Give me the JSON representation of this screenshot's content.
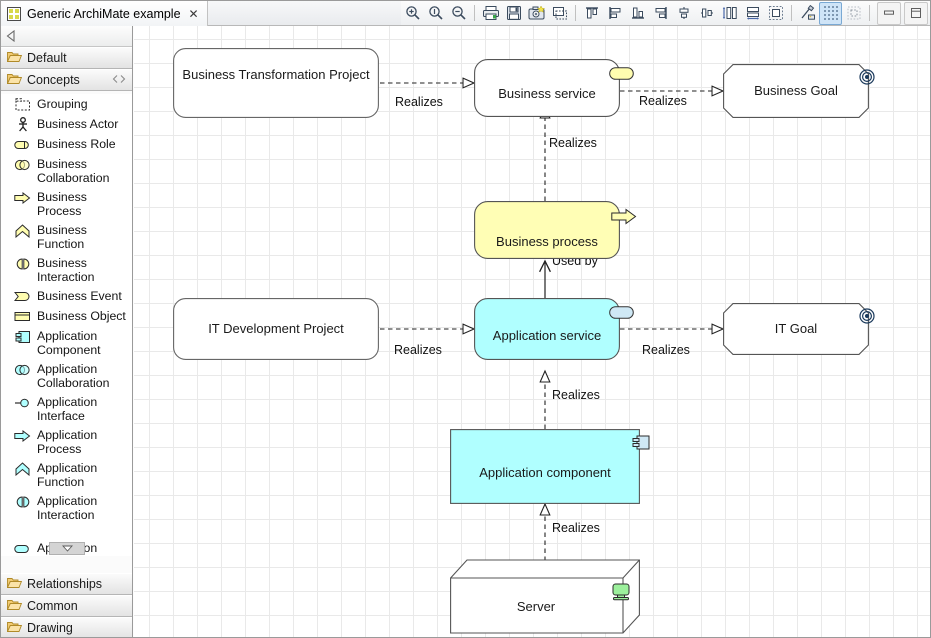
{
  "window": {
    "tab": {
      "title": "Generic ArchiMate example",
      "icon": "archimate-model-icon",
      "close": "✕"
    },
    "buttons": {
      "minimize": "minimize",
      "maximize": "maximize"
    }
  },
  "toolbar": {
    "items": [
      {
        "name": "zoom-in-icon",
        "label": "Zoom In"
      },
      {
        "name": "zoom-normal-icon",
        "label": "Zoom Normal"
      },
      {
        "name": "zoom-out-icon",
        "label": "Zoom Out"
      },
      {
        "name": "print-icon",
        "label": "Print"
      },
      {
        "name": "save-icon",
        "label": "Save"
      },
      {
        "name": "export-image-icon",
        "label": "Export as Image"
      },
      {
        "name": "fill-color-icon",
        "label": "Fill Color"
      },
      {
        "name": "align-top-icon",
        "label": "Align Top"
      },
      {
        "name": "align-left-icon",
        "label": "Align Left"
      },
      {
        "name": "align-bottom-icon",
        "label": "Align Bottom"
      },
      {
        "name": "align-right-icon",
        "label": "Align Right"
      },
      {
        "name": "align-center-icon",
        "label": "Align Center"
      },
      {
        "name": "align-middle-icon",
        "label": "Align Middle"
      },
      {
        "name": "match-height-icon",
        "label": "Match Height"
      },
      {
        "name": "match-width-icon",
        "label": "Match Width"
      },
      {
        "name": "default-size-icon",
        "label": "Default Size"
      },
      {
        "name": "format-painter-icon",
        "label": "Format Painter"
      },
      {
        "name": "toggle-grid-icon",
        "label": "Toggle Grid"
      },
      {
        "name": "snap-to-grid-icon",
        "label": "Snap to Grid"
      }
    ]
  },
  "sidebar": {
    "nav_back": "back-arrow",
    "sections": {
      "default": {
        "label": "Default",
        "icon": "folder-icon"
      },
      "concepts": {
        "label": "Concepts",
        "icon": "folder-icon",
        "collapse": "collapse-icon"
      }
    },
    "items": [
      {
        "label": "Grouping",
        "icon": "grouping-icon",
        "layer": "other"
      },
      {
        "label": "Business Actor",
        "icon": "business-actor-icon",
        "layer": "business"
      },
      {
        "label": "Business Role",
        "icon": "business-role-icon",
        "layer": "business"
      },
      {
        "label": "Business Collaboration",
        "icon": "business-collaboration-icon",
        "layer": "business"
      },
      {
        "label": "Business Process",
        "icon": "business-process-icon",
        "layer": "business"
      },
      {
        "label": "Business Function",
        "icon": "business-function-icon",
        "layer": "business"
      },
      {
        "label": "Business Interaction",
        "icon": "business-interaction-icon",
        "layer": "business"
      },
      {
        "label": "Business Event",
        "icon": "business-event-icon",
        "layer": "business"
      },
      {
        "label": "Business Object",
        "icon": "business-object-icon",
        "layer": "business"
      },
      {
        "label": "Application Component",
        "icon": "application-component-icon",
        "layer": "application"
      },
      {
        "label": "Application Collaboration",
        "icon": "application-collaboration-icon",
        "layer": "application"
      },
      {
        "label": "Application Interface",
        "icon": "application-interface-icon",
        "layer": "application"
      },
      {
        "label": "Application Process",
        "icon": "application-process-icon",
        "layer": "application"
      },
      {
        "label": "Application Function",
        "icon": "application-function-icon",
        "layer": "application"
      },
      {
        "label": "Application Interaction",
        "icon": "application-interaction-icon",
        "layer": "application"
      }
    ],
    "clipped_item": {
      "label": "Application",
      "icon": "application-service-icon"
    },
    "footer": [
      {
        "label": "Relationships",
        "icon": "folder-icon"
      },
      {
        "label": "Common",
        "icon": "folder-icon"
      },
      {
        "label": "Drawing",
        "icon": "folder-icon"
      }
    ]
  },
  "diagram": {
    "nodes": [
      {
        "id": "business-transformation-project",
        "label": "Business Transformation Project",
        "shape": "rounded-rect",
        "fill": "#ffffff",
        "badge": null
      },
      {
        "id": "business-service",
        "label": "Business service",
        "shape": "rounded-rect",
        "fill": "#ffffff",
        "badge": "service-badge"
      },
      {
        "id": "business-goal",
        "label": "Business Goal",
        "shape": "octagon",
        "fill": "#ffffff",
        "badge": "goal-badge"
      },
      {
        "id": "business-process",
        "label": "Business process",
        "shape": "rounded-rect",
        "fill": "#fffeb5",
        "badge": "process-arrow-badge"
      },
      {
        "id": "it-development-project",
        "label": "IT Development Project",
        "shape": "rounded-rect",
        "fill": "#ffffff",
        "badge": null
      },
      {
        "id": "application-service",
        "label": "Application service",
        "shape": "rounded-rect",
        "fill": "#b0ffff",
        "badge": "service-badge"
      },
      {
        "id": "it-goal",
        "label": "IT Goal",
        "shape": "octagon",
        "fill": "#ffffff",
        "badge": "goal-badge"
      },
      {
        "id": "application-component",
        "label": "Application component",
        "shape": "rect",
        "fill": "#b0ffff",
        "badge": "component-badge"
      },
      {
        "id": "server",
        "label": "Server",
        "shape": "node-3d",
        "fill": "#ffffff",
        "badge": "device-badge"
      }
    ],
    "edges": [
      {
        "from": "business-transformation-project",
        "to": "business-service",
        "label": "Realizes",
        "type": "realization"
      },
      {
        "from": "business-service",
        "to": "business-goal",
        "label": "Realizes",
        "type": "realization"
      },
      {
        "from": "business-process",
        "to": "business-service",
        "label": "Realizes",
        "type": "realization"
      },
      {
        "from": "application-service",
        "to": "business-process",
        "label": "Used by",
        "type": "serving"
      },
      {
        "from": "it-development-project",
        "to": "application-service",
        "label": "Realizes",
        "type": "realization"
      },
      {
        "from": "application-service",
        "to": "it-goal",
        "label": "Realizes",
        "type": "realization"
      },
      {
        "from": "application-component",
        "to": "application-service",
        "label": "Realizes",
        "type": "realization"
      },
      {
        "from": "server",
        "to": "application-component",
        "label": "Realizes",
        "type": "realization"
      }
    ],
    "colors": {
      "business": "#fffeb5",
      "application": "#b0ffff",
      "technology": "#b6ffb6",
      "line": "#555555"
    }
  }
}
